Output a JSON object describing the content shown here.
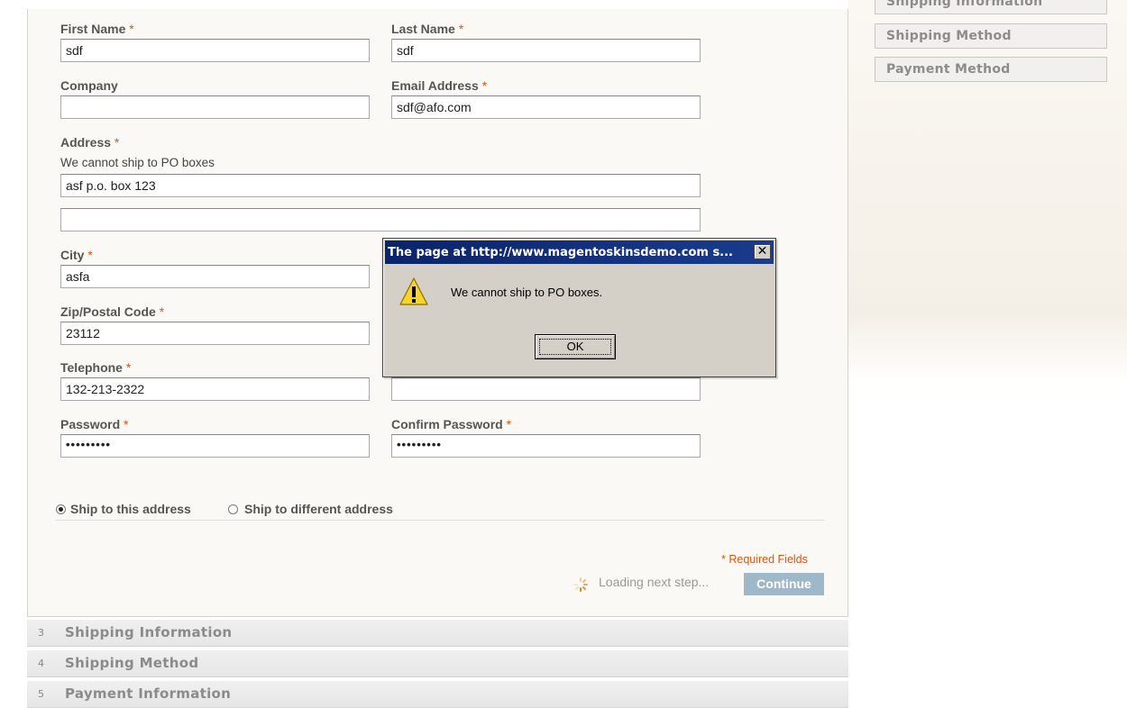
{
  "sidebar": {
    "items": [
      {
        "label": "Shipping Information"
      },
      {
        "label": "Shipping Method"
      },
      {
        "label": "Payment Method"
      }
    ]
  },
  "form": {
    "required_mark": "*",
    "first_name": {
      "label": "First Name",
      "value": "sdf"
    },
    "last_name": {
      "label": "Last Name",
      "value": "sdf"
    },
    "company": {
      "label": "Company",
      "value": ""
    },
    "email": {
      "label": "Email Address",
      "value": "sdf@afo.com"
    },
    "address": {
      "label": "Address",
      "note": "We cannot ship to PO boxes",
      "line1": "asf p.o. box 123",
      "line2": ""
    },
    "city": {
      "label": "City",
      "value": "asfa"
    },
    "zip": {
      "label": "Zip/Postal Code",
      "value": "23112"
    },
    "telephone": {
      "label": "Telephone",
      "value": "132-213-2322"
    },
    "fax": {
      "value": ""
    },
    "password": {
      "label": "Password",
      "value": "•••••••••"
    },
    "confirm_password": {
      "label": "Confirm Password",
      "value": "•••••••••"
    },
    "ship_options": [
      {
        "label": "Ship to this address",
        "selected": true
      },
      {
        "label": "Ship to different address",
        "selected": false
      }
    ],
    "required_fields": "* Required Fields",
    "loading_text": "Loading next step...",
    "continue_label": "Continue"
  },
  "steps": [
    {
      "num": "3",
      "label": "Shipping Information"
    },
    {
      "num": "4",
      "label": "Shipping Method"
    },
    {
      "num": "5",
      "label": "Payment Information"
    }
  ],
  "dialog": {
    "title": "The page at http://www.magentoskinsdemo.com s...",
    "close_label": "✕",
    "message": "We cannot ship to PO boxes.",
    "ok_label": "OK"
  },
  "colors": {
    "required": "#e0530f",
    "continue_button": "#9fb8c9",
    "dialog_title": "#0a246a"
  }
}
